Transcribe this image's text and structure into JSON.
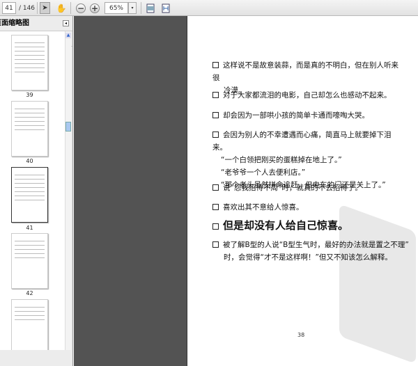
{
  "toolbar": {
    "current_page": "41",
    "total_pages": "/ 146",
    "zoom": "65%",
    "zoom_dropdown": "▾"
  },
  "panel": {
    "title": "页面缩略图",
    "options": "▾",
    "trash": "🗑",
    "collapse": "◂"
  },
  "thumbnails": [
    {
      "label": "39"
    },
    {
      "label": "40"
    },
    {
      "label": "41"
    },
    {
      "label": "42"
    }
  ],
  "document": {
    "items": [
      {
        "lines": [
          "这样说不是故意装蒜，而是真的不明白，但在别人听来很",
          "冷漠。"
        ]
      },
      {
        "lines": [
          "对于大家都流泪的电影，自己却怎么也感动不起来。"
        ]
      },
      {
        "lines": [
          "却会因为一部哄小孩的简单卡通而嚎啕大哭。"
        ]
      },
      {
        "lines": [
          "会因为别人的不幸遭遇而心痛，简直马上就要掉下泪来。",
          "“一个白领把刚买的蛋糕掉在地上了。”",
          "“老爷爷一个人去便利店。”",
          "“那个老头虽然拼命追赶，但电车的门还是关上了。”"
        ]
      },
      {
        "lines": [
          "说“怨我招待不周”时，就真的不去招待了。"
        ]
      },
      {
        "lines": [
          "喜欢出其不意给人惊喜。"
        ]
      },
      {
        "lines": [
          "但是却没有人给自己惊喜。"
        ]
      },
      {
        "lines": [
          "被了解B型的人说“B型生气时，最好的办法就是置之不理”",
          "时，会觉得“才不是这样啊！”但又不知该怎么解释。"
        ]
      }
    ],
    "page_number": "38"
  }
}
